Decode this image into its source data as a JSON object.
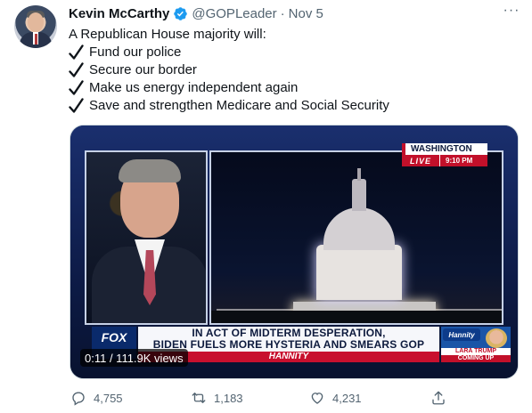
{
  "author": {
    "name": "Kevin McCarthy",
    "handle": "@GOPLeader",
    "separator": "·",
    "date": "Nov 5"
  },
  "more_label": "···",
  "tweet": {
    "intro": "A Republican House majority will:",
    "items": [
      "Fund our police",
      "Secure our border",
      "Make us energy independent again",
      "Save and strengthen Medicare and Social Security"
    ]
  },
  "video": {
    "location_badge": {
      "city": "WASHINGTON",
      "live": "LIVE",
      "time": "9:10 PM"
    },
    "network_logo": "FOX",
    "headline_line1": "IN ACT OF MIDTERM DESPERATION,",
    "headline_line2": "BIDEN FUELS MORE HYSTERIA AND SMEARS GOP",
    "show_name": "HANNITY",
    "promo": {
      "show": "Hannity",
      "guest": "LARA TRUMP",
      "status": "COMING UP"
    },
    "timecode": "0:11 / 111.9K views"
  },
  "actions": {
    "replies": "4,755",
    "retweets": "1,183",
    "likes": "4,231"
  },
  "colors": {
    "text": "#0f1419",
    "secondary": "#536471",
    "verified": "#1d9bf0",
    "fox_red": "#c2102a",
    "fox_blue": "#0a2a6b"
  }
}
